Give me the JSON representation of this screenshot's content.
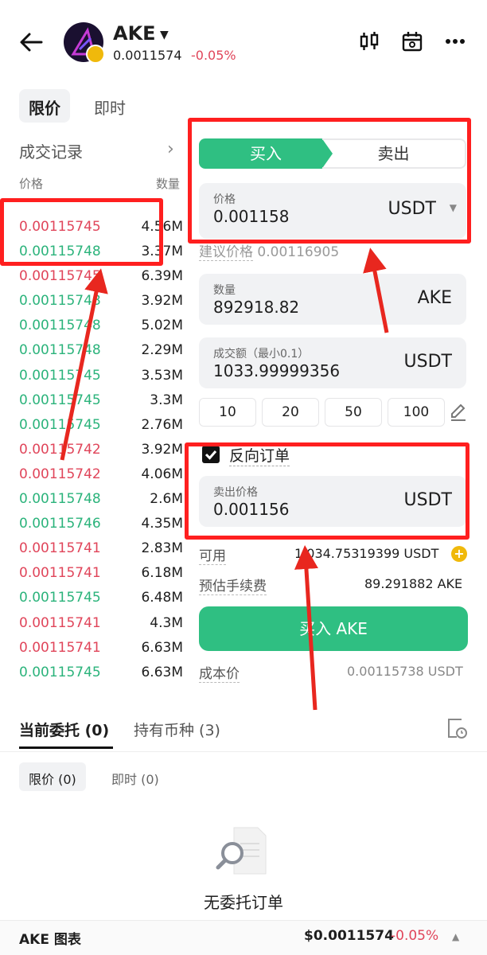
{
  "header": {
    "pair": "AKE",
    "last_price": "0.0011574",
    "change": "-0.05%",
    "colors": {
      "down": "#e0455a",
      "up": "#2bb37b",
      "accent": "#2fbf82"
    },
    "icons": [
      "back-arrow-icon",
      "candlestick-chart-icon",
      "calendar-icon",
      "more-icon"
    ]
  },
  "order_type_tabs": [
    "限价",
    "即时"
  ],
  "trades": {
    "title": "成交记录",
    "col_price": "价格",
    "col_qty": "数量",
    "rows": [
      {
        "price": "0.00115745",
        "qty": "4.56M",
        "side": "red"
      },
      {
        "price": "0.00115748",
        "qty": "3.37M",
        "side": "green"
      },
      {
        "price": "0.00115745",
        "qty": "6.39M",
        "side": "red"
      },
      {
        "price": "0.00115748",
        "qty": "3.92M",
        "side": "green"
      },
      {
        "price": "0.00115748",
        "qty": "5.02M",
        "side": "green"
      },
      {
        "price": "0.00115748",
        "qty": "2.29M",
        "side": "green"
      },
      {
        "price": "0.00115745",
        "qty": "3.53M",
        "side": "green"
      },
      {
        "price": "0.00115745",
        "qty": "3.3M",
        "side": "green"
      },
      {
        "price": "0.00115745",
        "qty": "2.76M",
        "side": "green"
      },
      {
        "price": "0.00115742",
        "qty": "3.92M",
        "side": "red"
      },
      {
        "price": "0.00115742",
        "qty": "4.06M",
        "side": "red"
      },
      {
        "price": "0.00115748",
        "qty": "2.6M",
        "side": "green"
      },
      {
        "price": "0.00115746",
        "qty": "4.35M",
        "side": "green"
      },
      {
        "price": "0.00115741",
        "qty": "2.83M",
        "side": "red"
      },
      {
        "price": "0.00115741",
        "qty": "6.18M",
        "side": "red"
      },
      {
        "price": "0.00115745",
        "qty": "6.48M",
        "side": "green"
      },
      {
        "price": "0.00115741",
        "qty": "4.3M",
        "side": "red"
      },
      {
        "price": "0.00115741",
        "qty": "6.63M",
        "side": "red"
      },
      {
        "price": "0.00115745",
        "qty": "6.63M",
        "side": "green"
      }
    ]
  },
  "form": {
    "buy_label": "买入",
    "sell_label": "卖出",
    "price_label": "价格",
    "price_value": "0.001158",
    "price_unit": "USDT",
    "suggest_label": "建议价格",
    "suggest_value": "0.00116905",
    "qty_label": "数量",
    "qty_value": "892918.82",
    "qty_unit": "AKE",
    "amount_label": "成交额（最小0.1）",
    "amount_value": "1033.99999356",
    "amount_unit": "USDT",
    "percent_buttons": [
      "10",
      "20",
      "50",
      "100"
    ],
    "reverse_label": "反向订单",
    "reverse_checked": true,
    "sell_price_label": "卖出价格",
    "sell_price_value": "0.001156",
    "sell_price_unit": "USDT",
    "available_label": "可用",
    "available_value": "1,034.75319399 USDT",
    "fee_label": "预估手续费",
    "fee_value": "89.291882 AKE",
    "submit_label": "买入 AKE",
    "cost_label": "成本价",
    "cost_value": "0.00115738 USDT"
  },
  "orders": {
    "tab_open": "当前委托 (0)",
    "tab_holdings": "持有币种 (3)",
    "sub_limit": "限价 (0)",
    "sub_market": "即时 (0)",
    "empty_text": "无委托订单"
  },
  "bottom_bar": {
    "title": "AKE 图表",
    "price": "$0.0011574",
    "change": "-0.05%"
  }
}
